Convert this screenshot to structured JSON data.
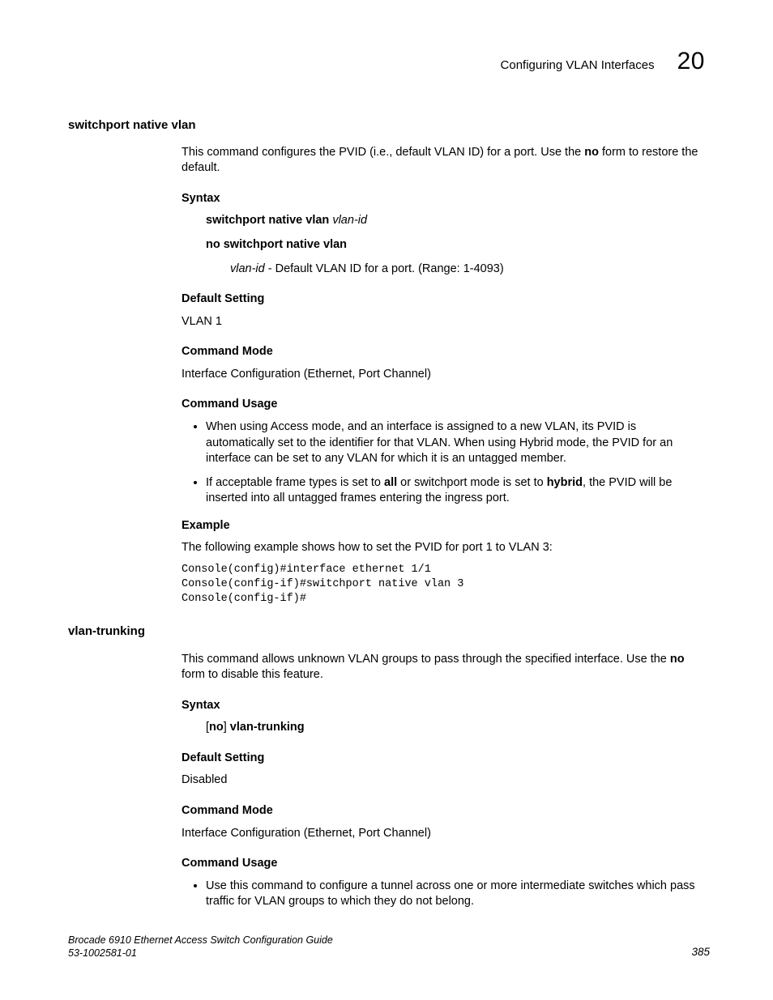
{
  "header": {
    "section_title": "Configuring VLAN Interfaces",
    "chapter_number": "20"
  },
  "cmd1": {
    "name": "switchport native vlan",
    "intro_a": "This command configures the PVID (i.e., default VLAN ID) for a port. Use the ",
    "intro_no": "no",
    "intro_b": " form to restore the default.",
    "syntax_head": "Syntax",
    "syntax_line1_cmd": "switchport native vlan",
    "syntax_line1_arg": " vlan-id",
    "syntax_line2": "no switchport native vlan",
    "param_name": "vlan-id",
    "param_desc": " - Default VLAN ID for a port. (Range: 1-4093)",
    "default_head": "Default Setting",
    "default_val": "VLAN 1",
    "mode_head": "Command Mode",
    "mode_val": "Interface Configuration (Ethernet, Port Channel)",
    "usage_head": "Command Usage",
    "usage_b1": "When using Access mode, and an interface is assigned to a new VLAN, its PVID is automatically set to the identifier for that VLAN. When using Hybrid mode, the PVID for an interface can be set to any VLAN for which it is an untagged member.",
    "usage_b2_a": "If acceptable frame types is set to ",
    "usage_b2_all": "all",
    "usage_b2_b": " or switchport mode is set to ",
    "usage_b2_hybrid": "hybrid",
    "usage_b2_c": ", the PVID will be inserted into all untagged frames entering the ingress port.",
    "example_head": "Example",
    "example_intro": "The following example shows how to set the PVID for port 1 to VLAN 3:",
    "example_code": "Console(config)#interface ethernet 1/1\nConsole(config-if)#switchport native vlan 3\nConsole(config-if)#"
  },
  "cmd2": {
    "name": "vlan-trunking",
    "intro_a": "This command allows unknown VLAN groups to pass through the specified interface. Use the ",
    "intro_no": "no",
    "intro_b": " form to disable this feature.",
    "syntax_head": "Syntax",
    "syntax_lb": "[",
    "syntax_no": "no",
    "syntax_rb": "]",
    "syntax_cmd": " vlan-trunking",
    "default_head": "Default Setting",
    "default_val": "Disabled",
    "mode_head": "Command Mode",
    "mode_val": "Interface Configuration (Ethernet, Port Channel)",
    "usage_head": "Command Usage",
    "usage_b1": "Use this command to configure a tunnel across one or more intermediate switches which pass traffic for VLAN groups to which they do not belong."
  },
  "footer": {
    "book": "Brocade 6910 Ethernet Access Switch Configuration Guide",
    "partnum": "53-1002581-01",
    "page": "385"
  }
}
